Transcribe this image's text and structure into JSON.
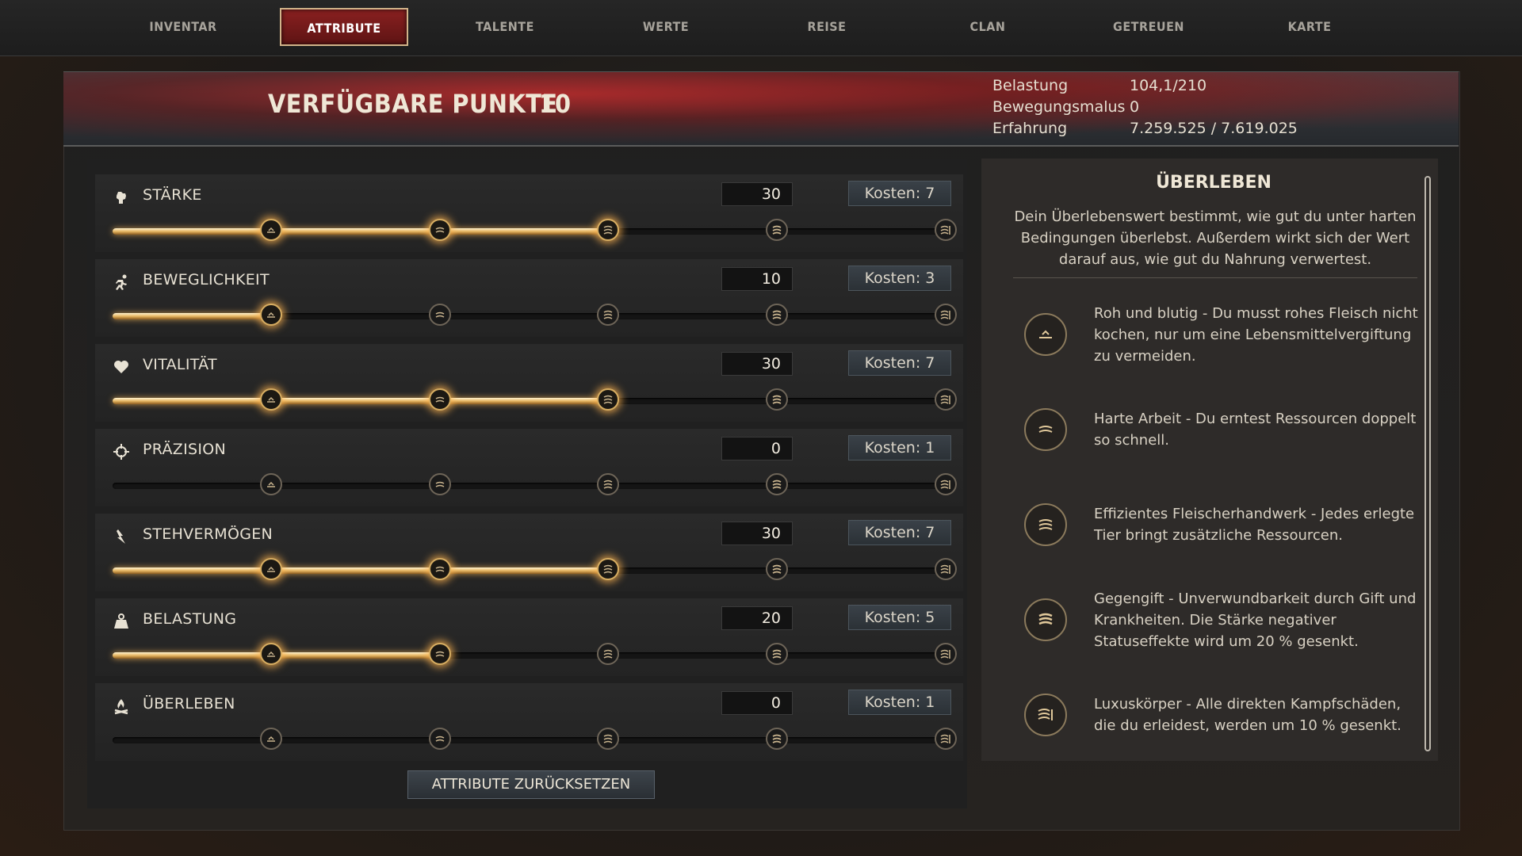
{
  "nav": {
    "tabs": [
      "INVENTAR",
      "ATTRIBUTE",
      "TALENTE",
      "WERTE",
      "REISE",
      "CLAN",
      "GETREUEN",
      "KARTE"
    ],
    "active": "ATTRIBUTE"
  },
  "header": {
    "title": "VERFÜGBARE PUNKTE",
    "points": "10",
    "stats": [
      {
        "label": "Belastung",
        "value": "104,1/210"
      },
      {
        "label": "Bewegungsmalus",
        "value": "0"
      },
      {
        "label": "Erfahrung",
        "value": "7.259.525 / 7.619.025"
      }
    ]
  },
  "attributes": [
    {
      "name": "STÄRKE",
      "value": "30",
      "cost": "Kosten: 7",
      "icon": "fist-icon",
      "filled_tiers": 3
    },
    {
      "name": "BEWEGLICHKEIT",
      "value": "10",
      "cost": "Kosten: 3",
      "icon": "running-man-icon",
      "filled_tiers": 1
    },
    {
      "name": "VITALITÄT",
      "value": "30",
      "cost": "Kosten: 7",
      "icon": "heart-icon",
      "filled_tiers": 3
    },
    {
      "name": "PRÄZISION",
      "value": "0",
      "cost": "Kosten: 1",
      "icon": "crosshair-icon",
      "filled_tiers": 0
    },
    {
      "name": "STEHVERMÖGEN",
      "value": "30",
      "cost": "Kosten: 7",
      "icon": "lightning-icon",
      "filled_tiers": 3
    },
    {
      "name": "BELASTUNG",
      "value": "20",
      "cost": "Kosten: 5",
      "icon": "weight-icon",
      "filled_tiers": 2
    },
    {
      "name": "ÜBERLEBEN",
      "value": "0",
      "cost": "Kosten: 1",
      "icon": "campfire-icon",
      "filled_tiers": 0
    }
  ],
  "reset_button": "ATTRIBUTE ZURÜCKSETZEN",
  "info": {
    "title": "ÜBERLEBEN",
    "description": "Dein Überlebenswert bestimmt, wie gut du unter harten Bedingungen überlebst. Außerdem wirkt sich der Wert darauf aus, wie gut du Nahrung verwertest.",
    "perks": [
      {
        "text": "Roh und blutig - Du musst rohes Fleisch nicht kochen, nur um eine Lebensmittelvergiftung zu vermeiden."
      },
      {
        "text": "Harte Arbeit - Du erntest Ressourcen doppelt so schnell."
      },
      {
        "text": "Effizientes Fleischerhandwerk - Jedes erlegte Tier bringt zusätzliche Ressourcen."
      },
      {
        "text": "Gegengift - Unverwundbarkeit durch Gift und Krankheiten. Die Stärke negativer Statuseffekte wird um 20 % gesenkt."
      },
      {
        "text": "Luxuskörper - Alle direkten Kampfschäden, die du erleidest, werden um 10 % gesenkt."
      }
    ]
  },
  "colors": {
    "accent_red": "#8a2020",
    "gold": "#d6ad62"
  }
}
